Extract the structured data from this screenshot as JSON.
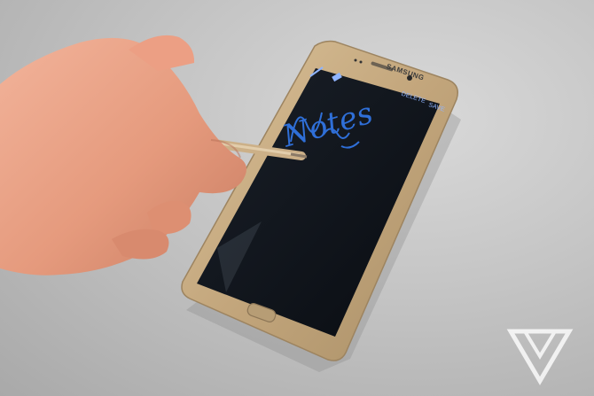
{
  "scene": {
    "device_brand": "SAMSUNG",
    "screen_actions": {
      "delete_label": "DELETE",
      "save_label": "SAVE"
    },
    "handwritten_note": "Notes"
  },
  "icons": {
    "pen_icon": "pen-icon",
    "eraser_icon": "eraser-icon",
    "watermark": "verge-logo-icon"
  },
  "colors": {
    "phone_frame": "#c9b089",
    "screen": "#0f141b",
    "ink": "#2f6fd8",
    "background": "#c4c4c4"
  }
}
